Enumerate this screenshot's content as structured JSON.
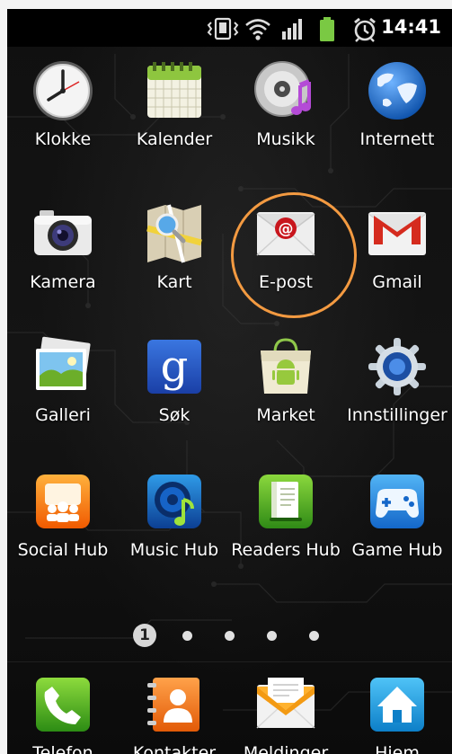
{
  "status_bar": {
    "time": "14:41",
    "icons": [
      "vibrate-icon",
      "wifi-icon",
      "signal-icon",
      "battery-icon",
      "alarm-icon"
    ]
  },
  "apps": [
    {
      "label": "Klokke",
      "icon": "clock-icon"
    },
    {
      "label": "Kalender",
      "icon": "calendar-icon"
    },
    {
      "label": "Musikk",
      "icon": "music-icon"
    },
    {
      "label": "Internett",
      "icon": "globe-icon"
    },
    {
      "label": "Kamera",
      "icon": "camera-icon"
    },
    {
      "label": "Kart",
      "icon": "map-icon"
    },
    {
      "label": "E-post",
      "icon": "email-icon"
    },
    {
      "label": "Gmail",
      "icon": "gmail-icon"
    },
    {
      "label": "Galleri",
      "icon": "gallery-icon"
    },
    {
      "label": "Søk",
      "icon": "google-search-icon"
    },
    {
      "label": "Market",
      "icon": "market-icon"
    },
    {
      "label": "Innstillinger",
      "icon": "settings-gear-icon"
    },
    {
      "label": "Social Hub",
      "icon": "social-hub-icon"
    },
    {
      "label": "Music Hub",
      "icon": "music-hub-icon"
    },
    {
      "label": "Readers Hub",
      "icon": "readers-hub-icon"
    },
    {
      "label": "Game Hub",
      "icon": "game-hub-icon"
    }
  ],
  "page_indicator": {
    "current": "1",
    "total_pages": 5
  },
  "dock": [
    {
      "label": "Telefon",
      "icon": "phone-icon"
    },
    {
      "label": "Kontakter",
      "icon": "contacts-icon"
    },
    {
      "label": "Meldinger",
      "icon": "messages-icon"
    },
    {
      "label": "Hjem",
      "icon": "home-icon"
    }
  ],
  "highlight_color": "#f39a41"
}
